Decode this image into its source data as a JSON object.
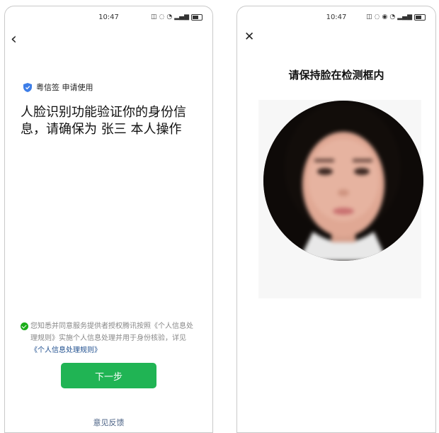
{
  "left_screen": {
    "status_time": "10:47",
    "app_name": "粤信签 申请使用",
    "title": "人脸识别功能验证你的身份信息，请确保为 张三 本人操作",
    "consent_text": "您知悉并同意服务提供者授权腾讯按照《个人信息处理规则》实施个人信息处理并用于身份核验，详见",
    "consent_link": "《个人信息处理规则》",
    "next_button": "下一步",
    "feedback_link": "意见反馈"
  },
  "right_screen": {
    "status_time": "10:47",
    "heading": "请保持脸在检测框内"
  },
  "colors": {
    "primary_green": "#20b454",
    "link_blue": "#1f4f8f"
  },
  "icons": [
    "back-chevron-icon",
    "shield-icon",
    "check-circle-icon",
    "close-icon",
    "wifi-icon",
    "signal-icon",
    "battery-icon"
  ]
}
